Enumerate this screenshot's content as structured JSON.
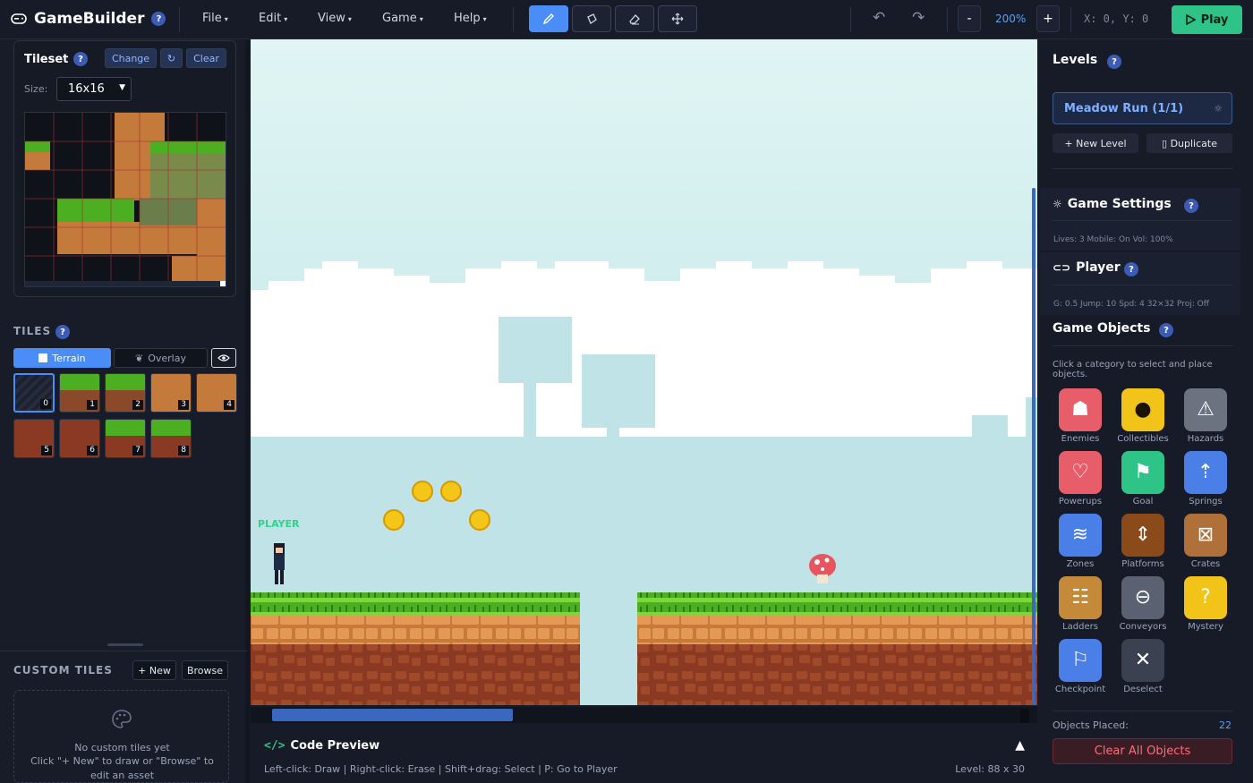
{
  "app": {
    "name": "GameBuilder"
  },
  "menu": [
    "File",
    "Edit",
    "View",
    "Game",
    "Help"
  ],
  "toolbar": {
    "zoom_out": "-",
    "zoom_level": "200%",
    "zoom_in": "+",
    "coords": "X: 0, Y: 0",
    "play": "Play"
  },
  "tileset": {
    "title": "Tileset",
    "change": "Change",
    "refresh": "↻",
    "clear": "Clear",
    "size_label": "Size:",
    "size_value": "16x16"
  },
  "tiles": {
    "title": "TILES",
    "tab_terrain": "Terrain",
    "tab_overlay": "Overlay",
    "items": [
      "0",
      "1",
      "2",
      "3",
      "4",
      "5",
      "6",
      "7",
      "8"
    ]
  },
  "custom": {
    "title": "CUSTOM TILES",
    "new": "+ New",
    "browse": "Browse",
    "empty1": "No custom tiles yet",
    "empty2": "Click \"+ New\" to draw or \"Browse\" to",
    "empty3": "edit an asset"
  },
  "canvas": {
    "player_label": "PLAYER"
  },
  "code": {
    "title": "Code Preview",
    "hint": "Left-click: Draw | Right-click: Erase | Shift+drag: Select | P: Go to Player",
    "level_size": "Level: 88 x 30"
  },
  "levels": {
    "title": "Levels",
    "current": "Meadow Run (1/1)",
    "new": "+ New Level",
    "duplicate": "▯ Duplicate"
  },
  "settings": {
    "title": "Game Settings",
    "summary": "Lives: 3  Mobile: On  Vol: 100%"
  },
  "player": {
    "title": "Player",
    "summary": "G: 0.5  Jump: 10  Spd: 4  32×32  Proj: Off"
  },
  "objects": {
    "title": "Game Objects",
    "desc1": "Click a category to select and place",
    "desc2": "objects.",
    "categories": [
      {
        "label": "Enemies",
        "color": "#e85d6a",
        "icon": "ghost-icon"
      },
      {
        "label": "Collectibles",
        "color": "#f2c318",
        "icon": "coin-icon"
      },
      {
        "label": "Hazards",
        "color": "#6b7280",
        "icon": "warning-icon"
      },
      {
        "label": "Powerups",
        "color": "#e85d6a",
        "icon": "heart-icon"
      },
      {
        "label": "Goal",
        "color": "#2fc487",
        "icon": "flag-icon"
      },
      {
        "label": "Springs",
        "color": "#4a7fe8",
        "icon": "spring-icon"
      },
      {
        "label": "Zones",
        "color": "#4a7fe8",
        "icon": "waves-icon"
      },
      {
        "label": "Platforms",
        "color": "#8b4a1a",
        "icon": "platform-icon"
      },
      {
        "label": "Crates",
        "color": "#b0703a",
        "icon": "crate-icon"
      },
      {
        "label": "Ladders",
        "color": "#c48a3a",
        "icon": "ladder-icon"
      },
      {
        "label": "Conveyors",
        "color": "#5a6170",
        "icon": "conveyor-icon"
      },
      {
        "label": "Mystery",
        "color": "#f2c318",
        "icon": "mystery-icon"
      },
      {
        "label": "Checkpoint",
        "color": "#4a7fe8",
        "icon": "checkpoint-icon"
      },
      {
        "label": "Deselect",
        "color": "#3a4150",
        "icon": "close-icon"
      }
    ],
    "placed_label": "Objects Placed:",
    "placed_count": "22",
    "clear_all": "Clear All Objects"
  },
  "colors": {
    "accent": "#4a8df7",
    "play": "#2fc487",
    "danger": "#e85d6a"
  }
}
